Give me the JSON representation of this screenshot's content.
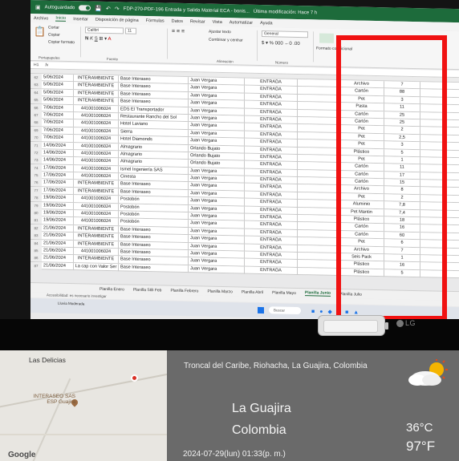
{
  "excel": {
    "titlebar": {
      "autosave_label": "Autoguardado",
      "doc_title": "FDP-270-PDF-196 Entrada y Salida Material ECA - bonis...",
      "last_modified": "Última modificación: Hace 7 h"
    },
    "menu": [
      "Archivo",
      "Inicio",
      "Insertar",
      "Disposición de página",
      "Fórmulas",
      "Datos",
      "Revisar",
      "Vista",
      "Automatizar",
      "Ayuda"
    ],
    "active_menu": "Inicio",
    "ribbon": {
      "cut": "Cortar",
      "copy": "Copiar",
      "format_painter": "Copiar formato",
      "clipboard_group": "Portapapeles",
      "font_name": "Calibri",
      "font_size": "11",
      "font_group": "Fuente",
      "wrap_text": "Ajustar texto",
      "merge_center": "Combinar y centrar",
      "alignment_group": "Alineación",
      "number_format": "General",
      "number_group": "Número",
      "conditional_format": "Formato condicional"
    },
    "formula_bar": {
      "cell_ref": "H1",
      "fx": "fx"
    },
    "rows": [
      {
        "n": "62",
        "date": "5/06/2024",
        "doc": "INTERAMBIENTE",
        "origen": "Base Interaseo",
        "resp": "Juan Vergara",
        "tipo": "ENTRADA",
        "mat": "Archivo",
        "qty": "7"
      },
      {
        "n": "63",
        "date": "5/06/2024",
        "doc": "INTERAMBIENTE",
        "origen": "Base Interaseo",
        "resp": "Juan Vergara",
        "tipo": "ENTRADA",
        "mat": "Cartón",
        "qty": "88"
      },
      {
        "n": "64",
        "date": "5/06/2024",
        "doc": "INTERAMBIENTE",
        "origen": "Base Interaseo",
        "resp": "Juan Vergara",
        "tipo": "ENTRADA",
        "mat": "Pet",
        "qty": "3"
      },
      {
        "n": "65",
        "date": "5/06/2024",
        "doc": "INTERAMBIENTE",
        "origen": "Base Interaseo",
        "resp": "Juan Vergara",
        "tipo": "ENTRADA",
        "mat": "Pasta",
        "qty": "11"
      },
      {
        "n": "66",
        "date": "7/06/2024",
        "doc": "441001006024",
        "origen": "EDS El Transportador",
        "resp": "Juan Vergara",
        "tipo": "ENTRADA",
        "mat": "Cartón",
        "qty": "25"
      },
      {
        "n": "67",
        "date": "7/06/2024",
        "doc": "441001006024",
        "origen": "Restaurante Rancho del Sol",
        "resp": "Juan Vergara",
        "tipo": "ENTRADA",
        "mat": "Cartón",
        "qty": "25"
      },
      {
        "n": "68",
        "date": "7/06/2024",
        "doc": "441001006024",
        "origen": "Hotel Laviano",
        "resp": "Juan Vergara",
        "tipo": "ENTRADA",
        "mat": "Pet",
        "qty": "2"
      },
      {
        "n": "69",
        "date": "7/06/2024",
        "doc": "441001006024",
        "origen": "Sierra",
        "resp": "Juan Vergara",
        "tipo": "ENTRADA",
        "mat": "Pet",
        "qty": "2,5"
      },
      {
        "n": "70",
        "date": "7/06/2024",
        "doc": "441001006024",
        "origen": "Hotel Diamonds",
        "resp": "Juan Vergara",
        "tipo": "ENTRADA",
        "mat": "Pet",
        "qty": "3"
      },
      {
        "n": "71",
        "date": "14/06/2024",
        "doc": "441001006024",
        "origen": "Almagrario",
        "resp": "Orlando Bujato",
        "tipo": "ENTRADA",
        "mat": "Plástico",
        "qty": "5"
      },
      {
        "n": "72",
        "date": "14/06/2024",
        "doc": "441001006024",
        "origen": "Almagrario",
        "resp": "Orlando Bujato",
        "tipo": "ENTRADA",
        "mat": "Pet",
        "qty": "1"
      },
      {
        "n": "73",
        "date": "14/06/2024",
        "doc": "441001006024",
        "origen": "Almagrario",
        "resp": "Orlando Bujato",
        "tipo": "ENTRADA",
        "mat": "Cartón",
        "qty": "11"
      },
      {
        "n": "74",
        "date": "17/06/2024",
        "doc": "441001006024",
        "origen": "Ismel Ingeniería SAS",
        "resp": "Juan Vergara",
        "tipo": "ENTRADA",
        "mat": "Cartón",
        "qty": "17"
      },
      {
        "n": "75",
        "date": "17/06/2024",
        "doc": "441001006024",
        "origen": "Cinesta",
        "resp": "Juan Vergara",
        "tipo": "ENTRADA",
        "mat": "Cartón",
        "qty": "15"
      },
      {
        "n": "76",
        "date": "17/06/2024",
        "doc": "INTERAMBIENTE",
        "origen": "Base Interaseo",
        "resp": "Juan Vergara",
        "tipo": "ENTRADA",
        "mat": "Archivo",
        "qty": "8"
      },
      {
        "n": "77",
        "date": "17/06/2024",
        "doc": "INTERAMBIENTE",
        "origen": "Base Interaseo",
        "resp": "Juan Vergara",
        "tipo": "ENTRADA",
        "mat": "Pet",
        "qty": "2"
      },
      {
        "n": "78",
        "date": "19/06/2024",
        "doc": "441001006024",
        "origen": "Postobón",
        "resp": "Juan Vergara",
        "tipo": "ENTRADA",
        "mat": "Aluminio",
        "qty": "7,8"
      },
      {
        "n": "79",
        "date": "19/06/2024",
        "doc": "441001006024",
        "origen": "Postobón",
        "resp": "Juan Vergara",
        "tipo": "ENTRADA",
        "mat": "Pet Mantin",
        "qty": "7,4"
      },
      {
        "n": "80",
        "date": "19/06/2024",
        "doc": "441001006024",
        "origen": "Postobón",
        "resp": "Juan Vergara",
        "tipo": "ENTRADA",
        "mat": "Plástico",
        "qty": "18"
      },
      {
        "n": "81",
        "date": "19/06/2024",
        "doc": "441001006024",
        "origen": "Postobón",
        "resp": "Juan Vergara",
        "tipo": "ENTRADA",
        "mat": "Cartón",
        "qty": "16"
      },
      {
        "n": "82",
        "date": "21/06/2024",
        "doc": "INTERAMBIENTE",
        "origen": "Base Interaseo",
        "resp": "Juan Vergara",
        "tipo": "ENTRADA",
        "mat": "Cartón",
        "qty": "60"
      },
      {
        "n": "83",
        "date": "21/06/2024",
        "doc": "INTERAMBIENTE",
        "origen": "Base Interaseo",
        "resp": "Juan Vergara",
        "tipo": "ENTRADA",
        "mat": "Pet",
        "qty": "6"
      },
      {
        "n": "84",
        "date": "21/06/2024",
        "doc": "INTERAMBIENTE",
        "origen": "Base Interaseo",
        "resp": "Juan Vergara",
        "tipo": "ENTRADA",
        "mat": "Archivo",
        "qty": "7"
      },
      {
        "n": "85",
        "date": "21/06/2024",
        "doc": "441001006024",
        "origen": "Base Interaseo",
        "resp": "Juan Vergara",
        "tipo": "ENTRADA",
        "mat": "Seis Pack",
        "qty": "1"
      },
      {
        "n": "86",
        "date": "21/06/2024",
        "doc": "INTERAMBIENTE",
        "origen": "Base Interaseo",
        "resp": "Juan Vergara",
        "tipo": "ENTRADA",
        "mat": "Plástico",
        "qty": "16"
      },
      {
        "n": "87",
        "date": "21/06/2024",
        "doc": "La cap con Valor Ser",
        "origen": "Base Interaseo",
        "resp": "Juan Vergara",
        "tipo": "ENTRADA",
        "mat": "Plástico",
        "qty": "5"
      }
    ],
    "sheet_tabs": [
      "Planilla Enero",
      "Planilla SIB Feb",
      "Planilla Febrero",
      "Planilla Marzo",
      "Planilla Abril",
      "Planilla Mayo",
      "Planilla Junio",
      "Planilla Julio"
    ],
    "active_sheet": "Planilla Junio",
    "status_text": "Accesibilidad: es necesario investigar",
    "taskbar": {
      "weather": "Lluvia Moderada",
      "search_placeholder": "Buscar"
    }
  },
  "bezel": {
    "brand": "LG"
  },
  "stamp": {
    "map_place": "Las Delicias",
    "map_poi": "INTERASEO SAS ESP Guajira",
    "map_credit": "Google",
    "address": "Troncal del Caribe, Riohacha, La Guajira, Colombia",
    "region": "La Guajira",
    "country": "Colombia",
    "datetime": "2024-07-29(lun)  01:33(p. m.)",
    "temp_c": "36°C",
    "temp_f": "97°F",
    "weather_icon": "partly-cloudy-icon"
  },
  "colors": {
    "excel_green": "#1d6b3b",
    "highlight_red": "#f01212",
    "overlay_gray": "#6a6a6a"
  }
}
